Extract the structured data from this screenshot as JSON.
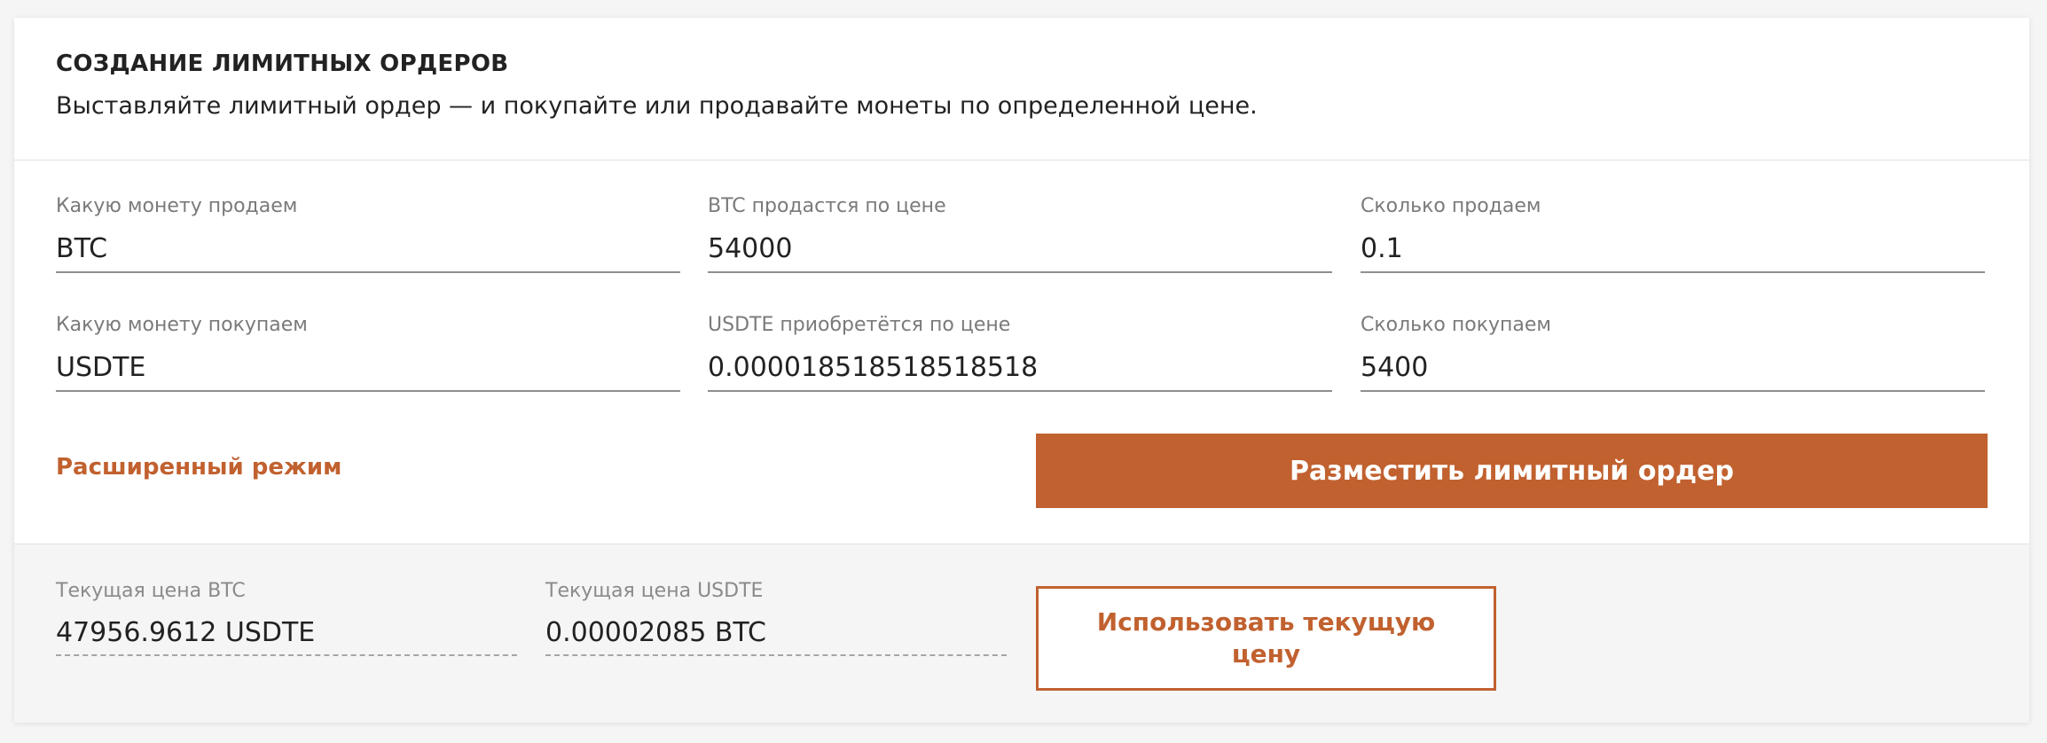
{
  "header": {
    "title": "СОЗДАНИЕ ЛИМИТНЫХ ОРДЕРОВ",
    "subtitle": "Выставляйте лимитный ордер — и покупайте или продавайте монеты по определенной цене."
  },
  "form": {
    "sell_coin": {
      "label": "Какую монету продаем",
      "value": "BTC"
    },
    "sell_price": {
      "label": "BTC продастся по цене",
      "value": "54000"
    },
    "sell_amount": {
      "label": "Сколько продаем",
      "value": "0.1"
    },
    "buy_coin": {
      "label": "Какую монету покупаем",
      "value": "USDTE"
    },
    "buy_price": {
      "label": "USDTE приобретётся по цене",
      "value": "0.000018518518518518"
    },
    "buy_amount": {
      "label": "Сколько покупаем",
      "value": "5400"
    }
  },
  "actions": {
    "advanced_mode": "Расширенный режим",
    "submit": "Разместить лимитный ордер",
    "use_current_price": "Использовать текущую цену"
  },
  "current_prices": {
    "btc": {
      "label": "Текущая цена BTC",
      "value": "47956.9612 USDTE"
    },
    "usdte": {
      "label": "Текущая цена USDTE",
      "value": "0.00002085 BTC"
    }
  },
  "colors": {
    "accent": "#c1612f",
    "background": "#f5f5f5",
    "card": "#ffffff"
  }
}
